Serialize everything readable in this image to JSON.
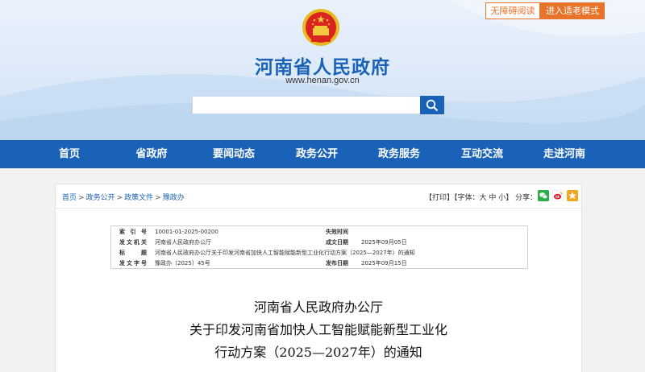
{
  "accessibility": {
    "barrier_free": "无障碍阅读",
    "elder_mode": "进入适老模式"
  },
  "site": {
    "title": "河南省人民政府",
    "url": "www.henan.gov.cn"
  },
  "search": {
    "placeholder": ""
  },
  "nav": {
    "items": [
      "首页",
      "省政府",
      "要闻动态",
      "政务公开",
      "政务服务",
      "互动交流",
      "走进河南"
    ]
  },
  "breadcrumb": {
    "items": [
      "首页",
      "政务公开",
      "政策文件",
      "豫政办"
    ],
    "separator": ">"
  },
  "tools": {
    "print": "【打印】",
    "font": "【字体：大 中 小】",
    "share_label": "分享："
  },
  "meta": {
    "rows": [
      {
        "k": "索引号",
        "v": "10001-01-2025-00200",
        "k2": "失效时间",
        "v2": ""
      },
      {
        "k": "发文机关",
        "v": "河南省人民政府办公厅",
        "k2": "成文日期",
        "v2": "2025年09月05日"
      },
      {
        "k": "标题",
        "v": "河南省人民政府办公厅关于印发河南省加快人工智能赋能新型工业化行动方案（2025—2027年）的通知",
        "k2": "",
        "v2": ""
      },
      {
        "k": "发文字号",
        "v": "豫政办〔2025〕45号",
        "k2": "发布日期",
        "v2": "2025年09月15日"
      }
    ]
  },
  "document": {
    "title_line1": "河南省人民政府办公厅",
    "title_line2": "关于印发河南省加快人工智能赋能新型工业化",
    "title_line3": "行动方案（2025—2027年）的通知"
  },
  "colors": {
    "brand_blue": "#1a62b8",
    "accent_orange": "#e8742b"
  }
}
